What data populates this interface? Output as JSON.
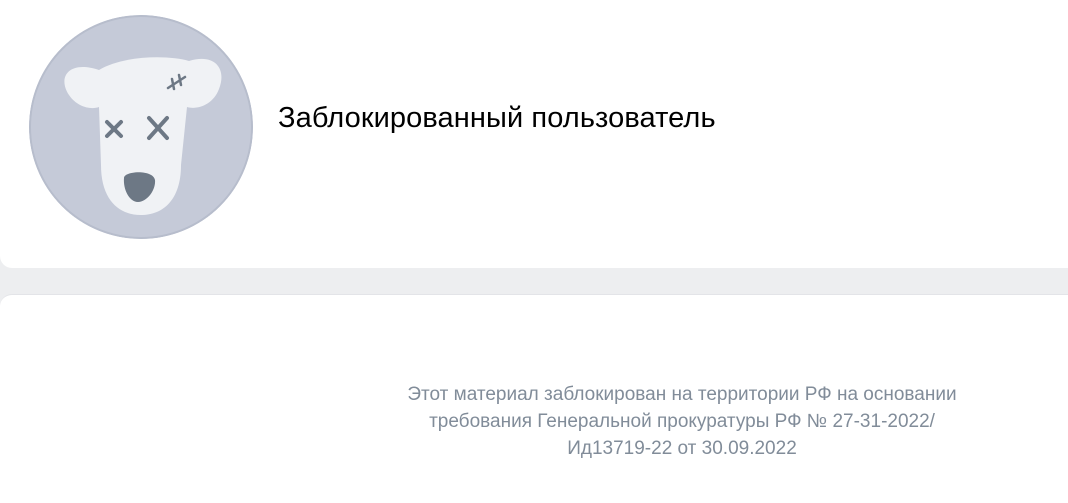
{
  "profile": {
    "name": "Заблокированный пользователь",
    "avatar_icon": "blocked-dog-icon",
    "avatar_bg": "#c5cad8",
    "avatar_face": "#f0f2f5",
    "avatar_marks": "#6d7885"
  },
  "notice": {
    "lines": [
      "Этот материал заблокирован на территории РФ на основании",
      "требования Генеральной прокуратуры РФ № 27-31-2022/",
      "Ид13719-22 от 30.09.2022"
    ],
    "text_color": "#818c99"
  }
}
